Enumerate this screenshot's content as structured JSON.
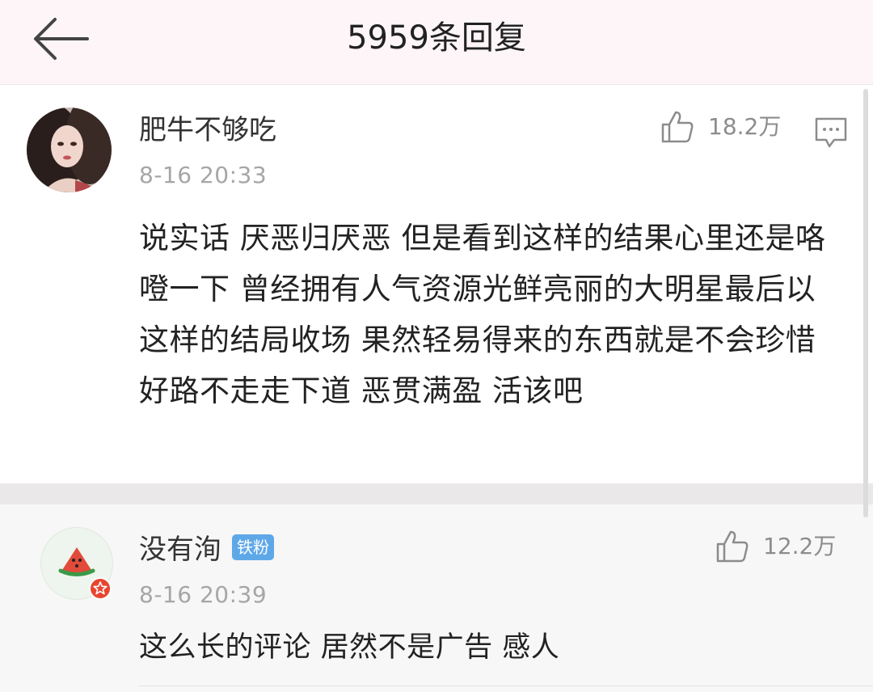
{
  "header": {
    "title": "5959条回复",
    "back_icon": "arrow-left-icon"
  },
  "main_comment": {
    "username": "肥牛不够吃",
    "time": "8-16 20:33",
    "likes": "18.2万",
    "text": "说实话 厌恶归厌恶 但是看到这样的结果心里还是咯噔一下 曾经拥有人气资源光鲜亮丽的大明星最后以这样的结局收场 果然轻易得来的东西就是不会珍惜 好路不走走下道 恶贯满盈 活该吧"
  },
  "reply": {
    "username": "没有洵",
    "badge": "铁粉",
    "time": "8-16 20:39",
    "likes": "12.2万",
    "text": "这么长的评论 居然不是广告 感人"
  },
  "colors": {
    "header_bg": "#fdf5f8",
    "badge_bg": "#5fa8e8",
    "vip_red": "#e8452f",
    "text_primary": "#222222",
    "text_muted": "#a6a6a6"
  }
}
